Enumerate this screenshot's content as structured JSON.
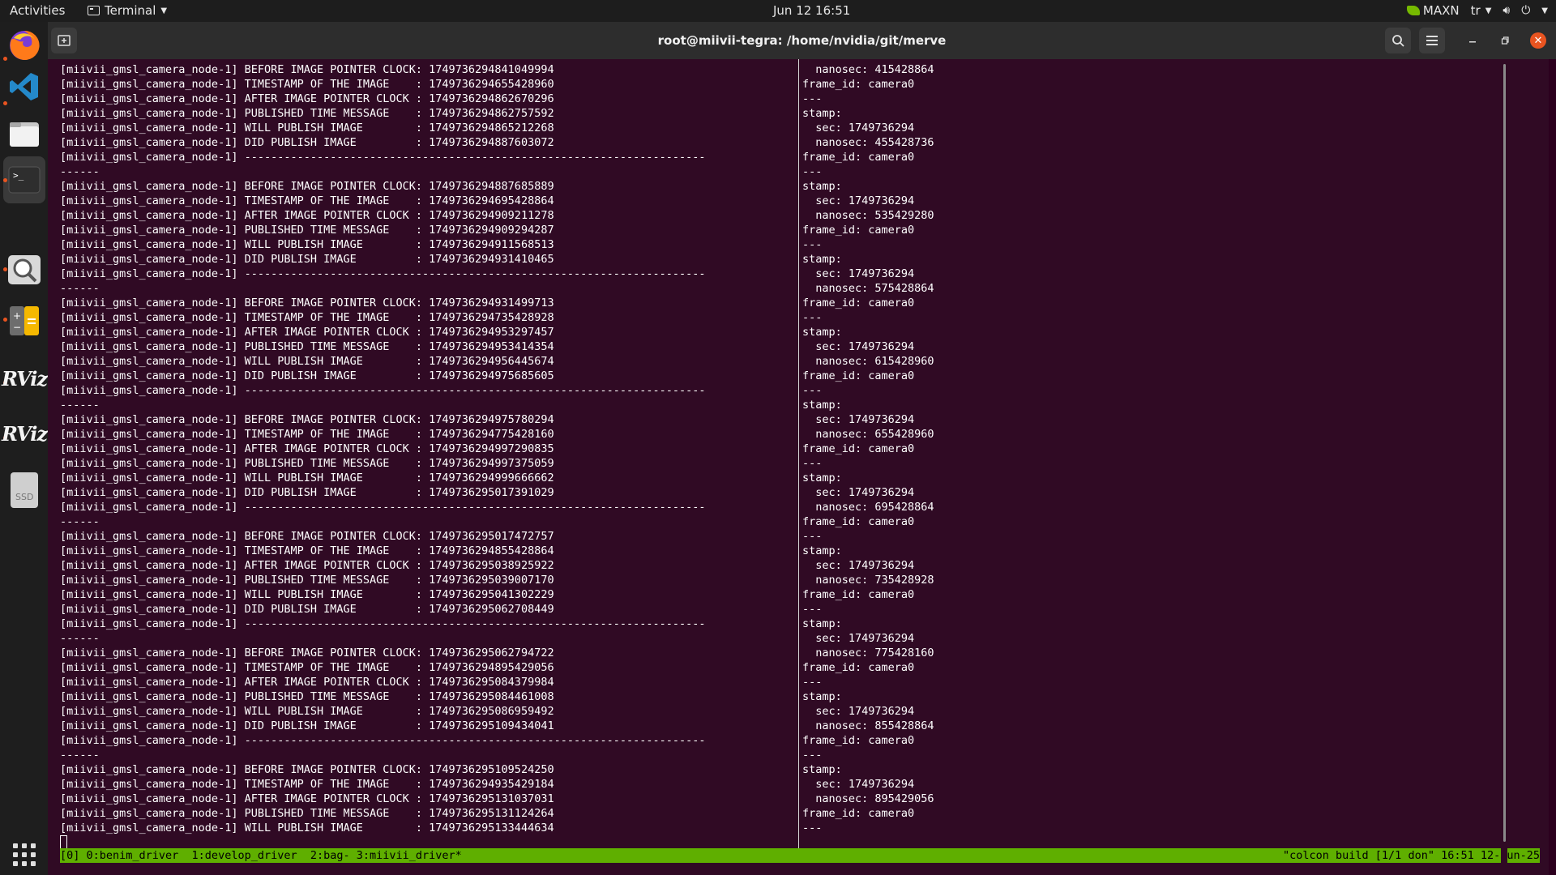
{
  "topbar": {
    "activities": "Activities",
    "app_name": "Terminal",
    "clock": "Jun 12  16:51",
    "nvidia_label": "MAXN",
    "keyboard_layout": "tr"
  },
  "dock": {
    "items": [
      "firefox",
      "vscode",
      "files",
      "terminal",
      "search",
      "calculator",
      "rviz",
      "rviz",
      "ssd-drive",
      "show-apps"
    ],
    "rviz_label": "RViz",
    "ssd_label": "SSD"
  },
  "window": {
    "title": "root@miivii-tegra: /home/nvidia/git/merve"
  },
  "left_pane_lines": [
    "[miivii_gmsl_camera_node-1] BEFORE IMAGE POINTER CLOCK: 1749736294841049994",
    "[miivii_gmsl_camera_node-1] TIMESTAMP OF THE IMAGE    : 1749736294655428960",
    "[miivii_gmsl_camera_node-1] AFTER IMAGE POINTER CLOCK : 1749736294862670296",
    "[miivii_gmsl_camera_node-1] PUBLISHED TIME MESSAGE    : 1749736294862757592",
    "[miivii_gmsl_camera_node-1] WILL PUBLISH IMAGE        : 1749736294865212268",
    "[miivii_gmsl_camera_node-1] DID PUBLISH IMAGE         : 1749736294887603072",
    "[miivii_gmsl_camera_node-1] ----------------------------------------------------------------------",
    "------",
    "[miivii_gmsl_camera_node-1] BEFORE IMAGE POINTER CLOCK: 1749736294887685889",
    "[miivii_gmsl_camera_node-1] TIMESTAMP OF THE IMAGE    : 1749736294695428864",
    "[miivii_gmsl_camera_node-1] AFTER IMAGE POINTER CLOCK : 1749736294909211278",
    "[miivii_gmsl_camera_node-1] PUBLISHED TIME MESSAGE    : 1749736294909294287",
    "[miivii_gmsl_camera_node-1] WILL PUBLISH IMAGE        : 1749736294911568513",
    "[miivii_gmsl_camera_node-1] DID PUBLISH IMAGE         : 1749736294931410465",
    "[miivii_gmsl_camera_node-1] ----------------------------------------------------------------------",
    "------",
    "[miivii_gmsl_camera_node-1] BEFORE IMAGE POINTER CLOCK: 1749736294931499713",
    "[miivii_gmsl_camera_node-1] TIMESTAMP OF THE IMAGE    : 1749736294735428928",
    "[miivii_gmsl_camera_node-1] AFTER IMAGE POINTER CLOCK : 1749736294953297457",
    "[miivii_gmsl_camera_node-1] PUBLISHED TIME MESSAGE    : 1749736294953414354",
    "[miivii_gmsl_camera_node-1] WILL PUBLISH IMAGE        : 1749736294956445674",
    "[miivii_gmsl_camera_node-1] DID PUBLISH IMAGE         : 1749736294975685605",
    "[miivii_gmsl_camera_node-1] ----------------------------------------------------------------------",
    "------",
    "[miivii_gmsl_camera_node-1] BEFORE IMAGE POINTER CLOCK: 1749736294975780294",
    "[miivii_gmsl_camera_node-1] TIMESTAMP OF THE IMAGE    : 1749736294775428160",
    "[miivii_gmsl_camera_node-1] AFTER IMAGE POINTER CLOCK : 1749736294997290835",
    "[miivii_gmsl_camera_node-1] PUBLISHED TIME MESSAGE    : 1749736294997375059",
    "[miivii_gmsl_camera_node-1] WILL PUBLISH IMAGE        : 1749736294999666662",
    "[miivii_gmsl_camera_node-1] DID PUBLISH IMAGE         : 1749736295017391029",
    "[miivii_gmsl_camera_node-1] ----------------------------------------------------------------------",
    "------",
    "[miivii_gmsl_camera_node-1] BEFORE IMAGE POINTER CLOCK: 1749736295017472757",
    "[miivii_gmsl_camera_node-1] TIMESTAMP OF THE IMAGE    : 1749736294855428864",
    "[miivii_gmsl_camera_node-1] AFTER IMAGE POINTER CLOCK : 1749736295038925922",
    "[miivii_gmsl_camera_node-1] PUBLISHED TIME MESSAGE    : 1749736295039007170",
    "[miivii_gmsl_camera_node-1] WILL PUBLISH IMAGE        : 1749736295041302229",
    "[miivii_gmsl_camera_node-1] DID PUBLISH IMAGE         : 1749736295062708449",
    "[miivii_gmsl_camera_node-1] ----------------------------------------------------------------------",
    "------",
    "[miivii_gmsl_camera_node-1] BEFORE IMAGE POINTER CLOCK: 1749736295062794722",
    "[miivii_gmsl_camera_node-1] TIMESTAMP OF THE IMAGE    : 1749736294895429056",
    "[miivii_gmsl_camera_node-1] AFTER IMAGE POINTER CLOCK : 1749736295084379984",
    "[miivii_gmsl_camera_node-1] PUBLISHED TIME MESSAGE    : 1749736295084461008",
    "[miivii_gmsl_camera_node-1] WILL PUBLISH IMAGE        : 1749736295086959492",
    "[miivii_gmsl_camera_node-1] DID PUBLISH IMAGE         : 1749736295109434041",
    "[miivii_gmsl_camera_node-1] ----------------------------------------------------------------------",
    "------",
    "[miivii_gmsl_camera_node-1] BEFORE IMAGE POINTER CLOCK: 1749736295109524250",
    "[miivii_gmsl_camera_node-1] TIMESTAMP OF THE IMAGE    : 1749736294935429184",
    "[miivii_gmsl_camera_node-1] AFTER IMAGE POINTER CLOCK : 1749736295131037031",
    "[miivii_gmsl_camera_node-1] PUBLISHED TIME MESSAGE    : 1749736295131124264",
    "[miivii_gmsl_camera_node-1] WILL PUBLISH IMAGE        : 1749736295133444634"
  ],
  "right_pane_lines": [
    "  nanosec: 415428864",
    "frame_id: camera0",
    "---",
    "stamp:",
    "  sec: 1749736294",
    "  nanosec: 455428736",
    "frame_id: camera0",
    "---",
    "stamp:",
    "  sec: 1749736294",
    "  nanosec: 535429280",
    "frame_id: camera0",
    "---",
    "stamp:",
    "  sec: 1749736294",
    "  nanosec: 575428864",
    "frame_id: camera0",
    "---",
    "stamp:",
    "  sec: 1749736294",
    "  nanosec: 615428960",
    "frame_id: camera0",
    "---",
    "stamp:",
    "  sec: 1749736294",
    "  nanosec: 655428960",
    "frame_id: camera0",
    "---",
    "stamp:",
    "  sec: 1749736294",
    "  nanosec: 695428864",
    "frame_id: camera0",
    "---",
    "stamp:",
    "  sec: 1749736294",
    "  nanosec: 735428928",
    "frame_id: camera0",
    "---",
    "stamp:",
    "  sec: 1749736294",
    "  nanosec: 775428160",
    "frame_id: camera0",
    "---",
    "stamp:",
    "  sec: 1749736294",
    "  nanosec: 855428864",
    "frame_id: camera0",
    "---",
    "stamp:",
    "  sec: 1749736294",
    "  nanosec: 895429056",
    "frame_id: camera0",
    "---"
  ],
  "tmux": {
    "left": "[0] 0:benim_driver  1:develop_driver  2:bag- 3:miivii_driver*",
    "right": "\"colcon build [1/1 don\" 16:51 12-Jun-25"
  },
  "colors": {
    "terminal_bg": "#300a24",
    "status_bar": "#5faf00",
    "accent": "#e95420"
  }
}
